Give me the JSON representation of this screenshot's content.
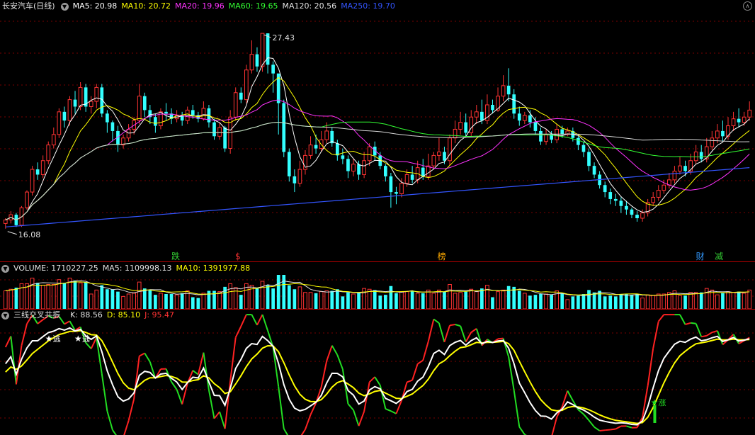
{
  "price_panel": {
    "title": "长安汽车(日线)",
    "ma": [
      {
        "label": "MA5: 20.98",
        "color": "#ffffff"
      },
      {
        "label": "MA10: 20.72",
        "color": "#ffff00"
      },
      {
        "label": "MA20: 19.96",
        "color": "#ff33ff"
      },
      {
        "label": "MA60: 19.65",
        "color": "#33ff33"
      },
      {
        "label": "MA120: 20.56",
        "color": "#e0e0e0"
      },
      {
        "label": "MA250: 19.70",
        "color": "#3355ff"
      }
    ],
    "high_label": "27.43",
    "low_label": "16.08",
    "markers": [
      {
        "text": "跌",
        "color": "#33cc33",
        "pos": 0.225
      },
      {
        "text": "$",
        "color": "#ff3333",
        "pos": 0.31
      },
      {
        "text": "榜",
        "color": "#ffaa00",
        "pos": 0.58
      },
      {
        "text": "财",
        "color": "#3399ff",
        "pos": 0.925
      },
      {
        "text": "减",
        "color": "#33cc33",
        "pos": 0.95
      }
    ]
  },
  "volume_panel": {
    "labels": [
      {
        "label": "VOLUME: 1710227.25",
        "color": "#e0e0e0"
      },
      {
        "label": "MA5: 1109998.13",
        "color": "#e0e0e0"
      },
      {
        "label": "MA10: 1391977.88",
        "color": "#ffff00"
      }
    ]
  },
  "indicator_panel": {
    "name": "三线交叉共振",
    "labels": [
      {
        "label": "K: 88.56",
        "color": "#e0e0e0"
      },
      {
        "label": "D: 85.10",
        "color": "#ffff00"
      },
      {
        "label": "J: 95.47",
        "color": "#ff3333"
      }
    ],
    "signals": [
      {
        "text": "逃",
        "icon": "star-icon",
        "pos": 0.062
      },
      {
        "text": "逃",
        "icon": "star-icon",
        "pos": 0.101
      },
      {
        "text": "涨",
        "icon": "star-icon",
        "pos": 0.87
      }
    ]
  },
  "chart_data": {
    "type": "candlestick",
    "price_range": [
      15.5,
      28.5
    ],
    "high": 27.43,
    "low": 16.08,
    "grid": true,
    "colors": {
      "up": "#ff3333",
      "down": "#33ffff"
    },
    "candles": [
      [
        16.5,
        16.7,
        16.2,
        16.8
      ],
      [
        16.7,
        17.0,
        16.5,
        17.2
      ],
      [
        17.0,
        16.4,
        16.3,
        17.1
      ],
      [
        16.4,
        17.4,
        16.3,
        17.5
      ],
      [
        17.4,
        18.3,
        17.3,
        18.4
      ],
      [
        18.3,
        19.6,
        18.1,
        19.8
      ],
      [
        19.6,
        19.3,
        19.0,
        20.0
      ],
      [
        19.3,
        20.1,
        19.1,
        20.4
      ],
      [
        20.1,
        21.0,
        19.9,
        21.2
      ],
      [
        21.0,
        21.6,
        20.8,
        22.0
      ],
      [
        21.6,
        22.9,
        21.4,
        23.1
      ],
      [
        22.9,
        22.4,
        22.0,
        23.2
      ],
      [
        22.4,
        23.6,
        22.1,
        23.8
      ],
      [
        23.6,
        23.2,
        22.8,
        24.1
      ],
      [
        23.2,
        24.3,
        23.0,
        24.6
      ],
      [
        24.3,
        23.2,
        22.9,
        24.5
      ],
      [
        23.2,
        23.5,
        22.8,
        23.8
      ],
      [
        23.5,
        24.3,
        23.1,
        24.5
      ],
      [
        24.3,
        22.8,
        22.6,
        24.5
      ],
      [
        22.8,
        22.3,
        21.7,
        23.0
      ],
      [
        22.3,
        21.8,
        21.2,
        22.4
      ],
      [
        21.8,
        21.0,
        20.6,
        22.1
      ],
      [
        21.0,
        21.4,
        20.8,
        21.6
      ],
      [
        21.4,
        21.9,
        21.2,
        22.2
      ],
      [
        21.9,
        22.4,
        21.6,
        22.6
      ],
      [
        22.4,
        23.8,
        22.2,
        24.5
      ],
      [
        23.8,
        23.0,
        22.6,
        24.0
      ],
      [
        23.0,
        22.6,
        22.2,
        23.3
      ],
      [
        22.6,
        22.1,
        21.7,
        22.8
      ],
      [
        22.1,
        22.9,
        21.9,
        23.1
      ],
      [
        22.9,
        22.8,
        22.4,
        23.4
      ],
      [
        22.8,
        22.5,
        22.2,
        23.1
      ],
      [
        22.5,
        22.7,
        22.3,
        23.0
      ],
      [
        22.7,
        22.4,
        22.1,
        22.9
      ],
      [
        22.4,
        23.0,
        22.2,
        23.2
      ],
      [
        23.0,
        22.7,
        22.5,
        23.3
      ],
      [
        22.7,
        22.5,
        22.3,
        22.9
      ],
      [
        22.5,
        23.1,
        22.4,
        23.5
      ],
      [
        23.1,
        22.3,
        22.0,
        23.3
      ],
      [
        22.3,
        21.5,
        21.3,
        22.5
      ],
      [
        21.5,
        22.0,
        21.3,
        22.3
      ],
      [
        22.0,
        20.8,
        20.6,
        22.1
      ],
      [
        20.8,
        22.6,
        20.5,
        23.0
      ],
      [
        22.6,
        24.0,
        22.4,
        24.3
      ],
      [
        24.0,
        23.6,
        23.4,
        24.3
      ],
      [
        23.6,
        25.3,
        23.4,
        25.6
      ],
      [
        25.3,
        26.2,
        25.1,
        27.0
      ],
      [
        26.2,
        25.5,
        25.2,
        26.6
      ],
      [
        25.5,
        27.4,
        25.2,
        27.4
      ],
      [
        27.4,
        25.6,
        25.1,
        27.4
      ],
      [
        25.6,
        25.1,
        24.0,
        25.8
      ],
      [
        25.1,
        23.4,
        21.6,
        25.0
      ],
      [
        23.4,
        20.6,
        20.3,
        23.6
      ],
      [
        20.6,
        19.2,
        18.9,
        20.8
      ],
      [
        19.2,
        18.8,
        18.3,
        19.6
      ],
      [
        18.8,
        19.6,
        18.6,
        20.1
      ],
      [
        19.6,
        20.4,
        19.3,
        20.7
      ],
      [
        20.4,
        21.0,
        20.2,
        21.5
      ],
      [
        21.0,
        20.8,
        20.5,
        21.6
      ],
      [
        20.8,
        21.3,
        20.6,
        21.8
      ],
      [
        21.3,
        21.8,
        21.1,
        22.3
      ],
      [
        21.8,
        21.1,
        20.9,
        22.0
      ],
      [
        21.1,
        20.4,
        20.1,
        21.3
      ],
      [
        20.4,
        20.2,
        19.9,
        20.8
      ],
      [
        20.2,
        19.5,
        19.1,
        20.4
      ],
      [
        19.5,
        19.9,
        19.2,
        20.2
      ],
      [
        19.9,
        19.3,
        19.0,
        20.1
      ],
      [
        19.3,
        20.1,
        19.1,
        20.6
      ],
      [
        20.1,
        20.9,
        19.8,
        21.1
      ],
      [
        20.9,
        20.4,
        20.1,
        21.2
      ],
      [
        20.4,
        19.8,
        19.6,
        20.6
      ],
      [
        19.8,
        19.2,
        18.9,
        19.9
      ],
      [
        19.2,
        18.3,
        17.4,
        19.4
      ],
      [
        18.3,
        18.2,
        17.6,
        18.6
      ],
      [
        18.2,
        18.8,
        18.0,
        19.1
      ],
      [
        18.8,
        19.3,
        18.6,
        19.6
      ],
      [
        19.3,
        19.0,
        18.8,
        19.8
      ],
      [
        19.0,
        19.7,
        18.8,
        20.1
      ],
      [
        19.7,
        19.2,
        19.0,
        20.2
      ],
      [
        19.2,
        19.8,
        19.0,
        20.5
      ],
      [
        19.8,
        20.4,
        19.6,
        20.6
      ],
      [
        20.4,
        20.6,
        20.1,
        21.4
      ],
      [
        20.6,
        20.1,
        19.9,
        20.9
      ],
      [
        20.1,
        21.4,
        19.8,
        21.6
      ],
      [
        21.4,
        21.9,
        21.1,
        22.4
      ],
      [
        21.9,
        22.3,
        21.6,
        22.9
      ],
      [
        22.3,
        21.7,
        21.5,
        22.8
      ],
      [
        21.7,
        22.6,
        21.5,
        23.0
      ],
      [
        22.6,
        22.9,
        22.2,
        23.3
      ],
      [
        22.9,
        22.4,
        22.2,
        23.6
      ],
      [
        22.4,
        23.3,
        22.2,
        23.9
      ],
      [
        23.3,
        23.0,
        22.8,
        23.6
      ],
      [
        23.0,
        23.8,
        22.9,
        24.3
      ],
      [
        23.8,
        24.4,
        23.5,
        25.0
      ],
      [
        24.4,
        23.9,
        23.5,
        25.4
      ],
      [
        23.9,
        22.8,
        22.5,
        24.2
      ],
      [
        22.8,
        22.4,
        22.1,
        23.2
      ],
      [
        22.4,
        22.7,
        22.2,
        22.9
      ],
      [
        22.7,
        22.3,
        22.0,
        23.0
      ],
      [
        22.3,
        21.8,
        21.6,
        22.6
      ],
      [
        21.8,
        21.2,
        21.0,
        22.0
      ],
      [
        21.2,
        21.6,
        21.0,
        21.9
      ],
      [
        21.6,
        21.3,
        21.1,
        21.8
      ],
      [
        21.3,
        21.9,
        21.1,
        22.2
      ],
      [
        21.9,
        21.6,
        21.4,
        22.1
      ],
      [
        21.6,
        21.8,
        21.5,
        22.0
      ],
      [
        21.8,
        21.4,
        21.2,
        22.0
      ],
      [
        21.4,
        21.0,
        20.7,
        21.5
      ],
      [
        21.0,
        20.6,
        20.3,
        21.2
      ],
      [
        20.6,
        19.8,
        19.5,
        20.8
      ],
      [
        19.8,
        19.3,
        19.1,
        20.0
      ],
      [
        19.3,
        18.7,
        18.5,
        19.5
      ],
      [
        18.7,
        18.3,
        18.0,
        18.9
      ],
      [
        18.3,
        17.9,
        17.6,
        18.5
      ],
      [
        17.9,
        17.8,
        17.5,
        18.2
      ],
      [
        17.8,
        17.5,
        17.1,
        18.0
      ],
      [
        17.5,
        17.3,
        17.0,
        17.8
      ],
      [
        17.3,
        17.0,
        16.8,
        17.4
      ],
      [
        17.0,
        16.8,
        16.6,
        17.2
      ],
      [
        16.8,
        17.1,
        16.6,
        17.3
      ],
      [
        17.1,
        17.7,
        16.9,
        17.9
      ],
      [
        17.7,
        18.0,
        17.5,
        18.3
      ],
      [
        18.0,
        18.4,
        17.8,
        18.7
      ],
      [
        18.4,
        18.7,
        18.2,
        19.0
      ],
      [
        18.7,
        19.0,
        18.5,
        19.4
      ],
      [
        19.0,
        19.5,
        18.8,
        19.8
      ],
      [
        19.5,
        19.8,
        19.3,
        20.3
      ],
      [
        19.8,
        19.5,
        19.2,
        20.1
      ],
      [
        19.5,
        20.1,
        19.3,
        20.5
      ],
      [
        20.1,
        20.6,
        19.9,
        21.0
      ],
      [
        20.6,
        20.2,
        20.0,
        21.0
      ],
      [
        20.2,
        20.9,
        20.0,
        21.4
      ],
      [
        20.9,
        21.4,
        20.7,
        21.8
      ],
      [
        21.4,
        21.8,
        21.1,
        22.2
      ],
      [
        21.8,
        21.5,
        21.2,
        22.4
      ],
      [
        21.5,
        22.1,
        21.3,
        22.6
      ],
      [
        22.1,
        22.5,
        21.8,
        22.9
      ],
      [
        22.5,
        22.3,
        22.0,
        23.1
      ],
      [
        22.3,
        22.6,
        22.1,
        22.9
      ],
      [
        22.6,
        23.0,
        22.4,
        23.5
      ]
    ],
    "volume_range": [
      0,
      4000000
    ],
    "volume_ma5": 1109998.13,
    "volume_ma10": 1391977.88,
    "kdj": {
      "k": 88.56,
      "d": 85.1,
      "j": 95.47,
      "range": [
        0,
        100
      ]
    }
  }
}
